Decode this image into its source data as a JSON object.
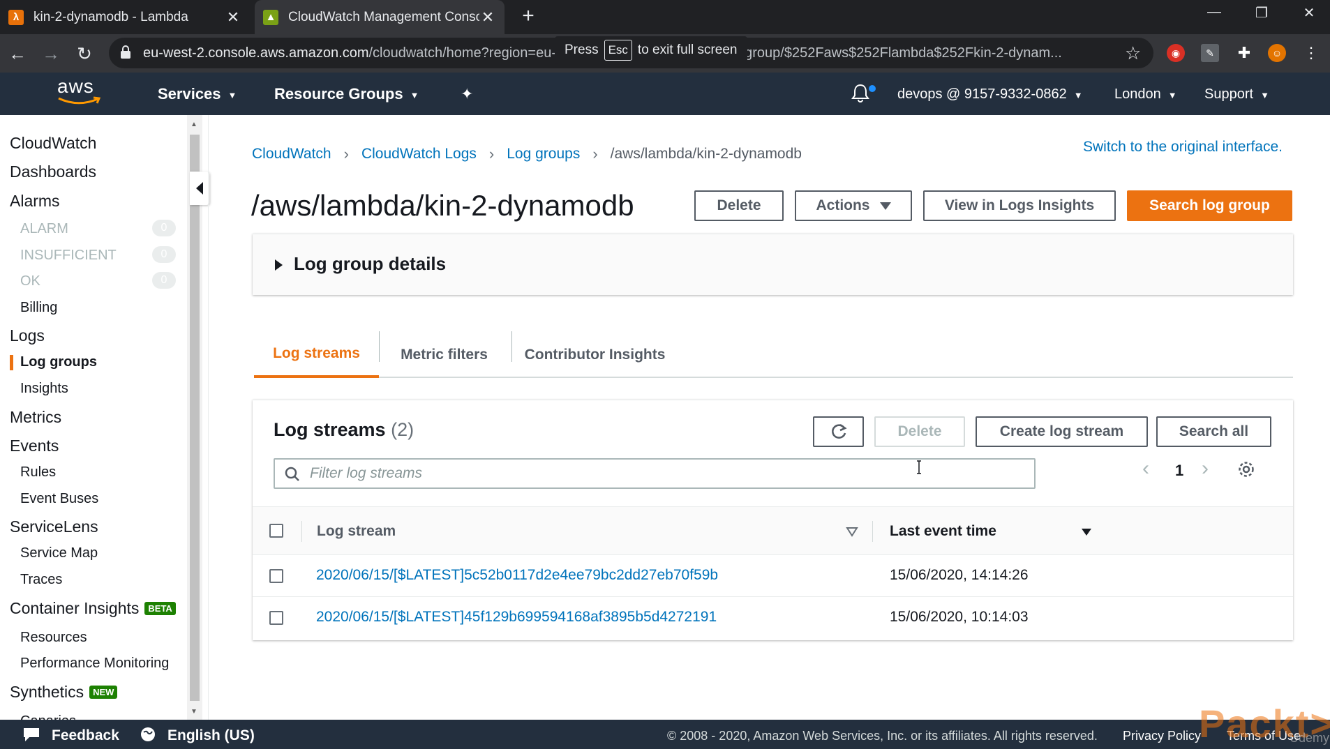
{
  "browser": {
    "tabs": [
      {
        "title": "kin-2-dynamodb - Lambda",
        "active": false,
        "favicon": "lambda-icon"
      },
      {
        "title": "CloudWatch Management Conso",
        "active": true,
        "favicon": "cloudwatch-icon"
      }
    ],
    "url_host": "eu-west-2.console.aws.amazon.com",
    "url_path": "/cloudwatch/home?region=eu-west-2#logsV2:log-groups/log-group/$252Faws$252Flambda$252Fkin-2-dynam...",
    "fullscreen_tip": {
      "press": "Press",
      "key": "Esc",
      "rest": "to exit full screen"
    }
  },
  "aws_header": {
    "services": "Services",
    "resource_groups": "Resource Groups",
    "account": "devops @ 9157-9332-0862",
    "region": "London",
    "support": "Support"
  },
  "sidebar": {
    "cloudwatch": "CloudWatch",
    "dashboards": "Dashboards",
    "alarms": "Alarms",
    "alarm_states": [
      {
        "label": "ALARM",
        "count": "0"
      },
      {
        "label": "INSUFFICIENT",
        "count": "0"
      },
      {
        "label": "OK",
        "count": "0"
      }
    ],
    "billing": "Billing",
    "logs": "Logs",
    "log_groups": "Log groups",
    "insights": "Insights",
    "metrics": "Metrics",
    "events": "Events",
    "rules": "Rules",
    "event_buses": "Event Buses",
    "servicelens": "ServiceLens",
    "service_map": "Service Map",
    "traces": "Traces",
    "container_insights": "Container Insights",
    "beta_badge": "BETA",
    "resources": "Resources",
    "performance_monitoring": "Performance Monitoring",
    "synthetics": "Synthetics",
    "new_badge": "NEW",
    "canaries": "Canaries"
  },
  "breadcrumb": {
    "items": [
      "CloudWatch",
      "CloudWatch Logs",
      "Log groups"
    ],
    "current": "/aws/lambda/kin-2-dynamodb"
  },
  "switch_link": "Switch to the original interface.",
  "page": {
    "title": "/aws/lambda/kin-2-dynamodb",
    "delete": "Delete",
    "actions": "Actions",
    "view_insights": "View in Logs Insights",
    "search_group": "Search log group",
    "details": "Log group details"
  },
  "tabs": {
    "log_streams": "Log streams",
    "metric_filters": "Metric filters",
    "contributor_insights": "Contributor Insights"
  },
  "streams": {
    "title": "Log streams",
    "count": "(2)",
    "delete": "Delete",
    "create": "Create log stream",
    "search_all": "Search all",
    "filter_placeholder": "Filter log streams",
    "page": "1",
    "col_stream": "Log stream",
    "col_time": "Last event time",
    "rows": [
      {
        "name": "2020/06/15/[$LATEST]5c52b0117d2e4ee79bc2dd27eb70f59b",
        "time": "15/06/2020, 14:14:26"
      },
      {
        "name": "2020/06/15/[$LATEST]45f129b699594168af3895b5d4272191",
        "time": "15/06/2020, 10:14:03"
      }
    ]
  },
  "footer": {
    "feedback": "Feedback",
    "language": "English (US)",
    "copyright": "© 2008 - 2020, Amazon Web Services, Inc. or its affiliates. All rights reserved.",
    "privacy": "Privacy Policy",
    "terms": "Terms of Use"
  },
  "watermark": {
    "brand": "Packt>",
    "sub": "Udemy"
  },
  "colors": {
    "accent": "#ec7211",
    "link": "#0073bb",
    "header": "#232f3e"
  }
}
